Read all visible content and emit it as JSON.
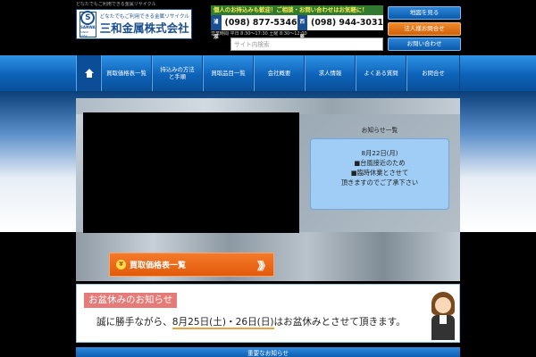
{
  "header": {
    "tagline": "どなたでもご利用できる金属リサイクル",
    "logo": {
      "catch": "どなたでもご利用できる金属リサイクル",
      "company": "三和金属株式会社",
      "mark_letter": "S",
      "mark_word": "SANWA",
      "mark_since": "SINCE 1952"
    },
    "phone_notice": "個人のお持込みも歓迎！ご相談・お問い合わせはお気軽に！",
    "phones": [
      {
        "area": "浦添",
        "number": "(098) 877-5346"
      },
      {
        "area": "西原",
        "number": "(098) 944-3031"
      }
    ],
    "hours": "営業時間 平日 8:30～17:30 土曜 8:30～12:00",
    "search_placeholder": "サイト内検索",
    "buttons": {
      "map": "地図を見る",
      "corporate": "法人様お問合せ",
      "contact": "お問い合わせ"
    }
  },
  "nav": {
    "items": [
      "買取価格表一覧",
      "持込みの方法\nと手順",
      "買取品目一覧",
      "会社概要",
      "求人情報",
      "よくある質問",
      "お問合せ"
    ]
  },
  "hero": {
    "notice_heading": "お知らせ一覧",
    "notice_lines": [
      "8月22日(月)",
      "■台風接近のため",
      "■臨時休業とさせて",
      "頂きますのでご了承下さい"
    ]
  },
  "price_banner": {
    "yen": "¥",
    "label": "買取価格表一覧",
    "arrows": "》》"
  },
  "obon": {
    "title": "お盆休みのお知らせ",
    "text_before": "誠に勝手ながら、",
    "text_highlight": "8月25日(土)・26日(日)",
    "text_after": "はお盆休みとさせて頂きます。"
  },
  "important": {
    "label": "重要なお知らせ"
  }
}
